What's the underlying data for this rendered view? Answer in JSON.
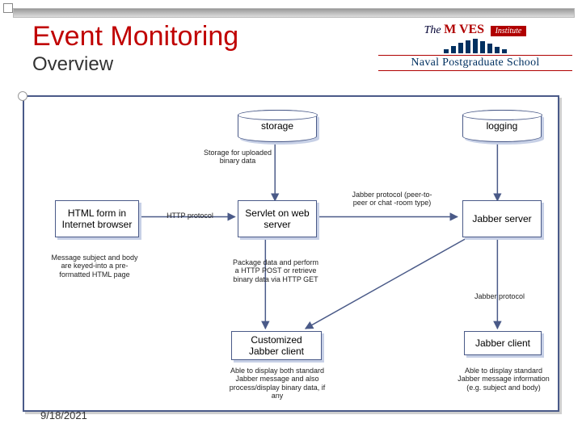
{
  "title": "Event Monitoring",
  "subtitle": "Overview",
  "logo": {
    "moves_prefix": "The",
    "moves_caps": "M VES",
    "institute_word": "Institute",
    "nps": "Naval Postgraduate School"
  },
  "date": "9/18/2021",
  "nodes": {
    "storage": "storage",
    "logging": "logging",
    "html_form": "HTML form in Internet browser",
    "servlet": "Servlet on web server",
    "jabber_server": "Jabber server",
    "custom_client": "Customized Jabber client",
    "jabber_client": "Jabber client"
  },
  "annotations": {
    "storage_uploaded": "Storage for uploaded binary data",
    "http_protocol": "HTTP protocol",
    "jabber_protocol_peer": "Jabber protocol (peer-to-peer or chat -room type)",
    "jabber_protocol": "Jabber protocol",
    "message_subject": "Message subject and body are keyed-into a pre-formatted HTML page",
    "package_data": "Package data and perform a HTTP POST or retrieve binary data via HTTP GET",
    "display_both": "Able to display both standard Jabber message and also process/display binary data, if any",
    "display_standard": "Able to display standard Jabber message information (e.g. subject and body)"
  }
}
